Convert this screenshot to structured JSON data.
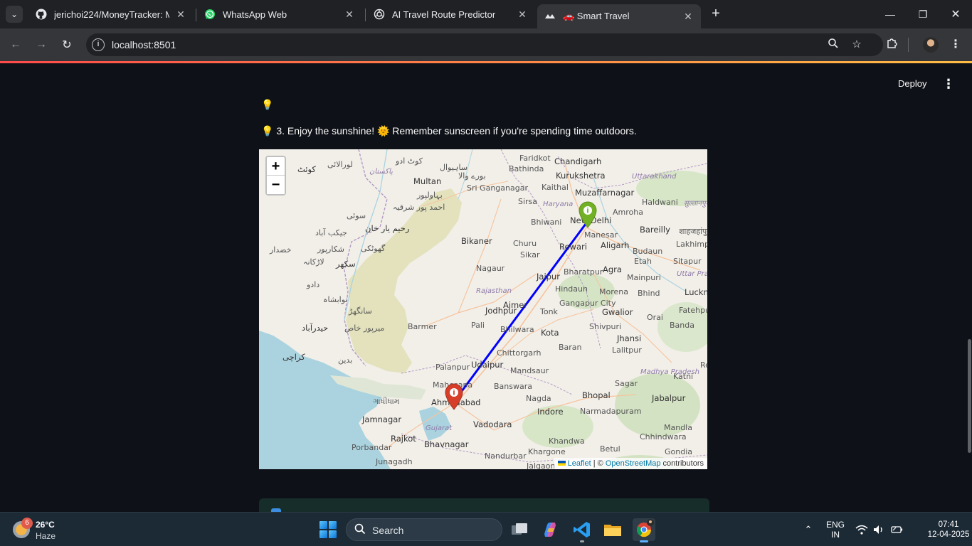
{
  "browser": {
    "tabs": [
      {
        "title": "jerichoi224/MoneyTracker: Mon",
        "icon": "github-icon"
      },
      {
        "title": "WhatsApp Web",
        "icon": "whatsapp-icon"
      },
      {
        "title": "AI Travel Route Predictor",
        "icon": "openai-icon"
      },
      {
        "title": "🚗 Smart Travel",
        "icon": "streamlit-icon",
        "active": true
      }
    ],
    "url": "localhost:8501"
  },
  "app": {
    "deploy_label": "Deploy",
    "tip_empty": "💡",
    "tip_text": "💡 3. Enjoy the sunshine! 🌞 Remember sunscreen if you're spending time outdoors."
  },
  "map": {
    "zoom_in": "+",
    "zoom_out": "−",
    "attribution": {
      "leaflet": "Leaflet",
      "sep": " | © ",
      "osm": "OpenStreetMap",
      "suffix": " contributors"
    },
    "route_color": "#0000ff",
    "start_marker_color": "#72b026",
    "end_marker_color": "#d63e2a",
    "places": [
      {
        "label": "Chandigarh",
        "cls": "city"
      },
      {
        "label": "Kurukshetra",
        "cls": "city"
      },
      {
        "label": "Muzaffarnagar",
        "cls": "city"
      },
      {
        "label": "Uttarakhand",
        "cls": "region"
      },
      {
        "label": "Faridkot",
        "cls": ""
      },
      {
        "label": "Bathinda",
        "cls": ""
      },
      {
        "label": "Kaithal",
        "cls": ""
      },
      {
        "label": "Sri Ganganagar",
        "cls": ""
      },
      {
        "label": "Haryana",
        "cls": "region"
      },
      {
        "label": "Sirsa",
        "cls": ""
      },
      {
        "label": "Haldwani",
        "cls": ""
      },
      {
        "label": "Amroha",
        "cls": ""
      },
      {
        "label": "Bhiwani",
        "cls": ""
      },
      {
        "label": "New Delhi",
        "cls": "city"
      },
      {
        "label": "Manesar",
        "cls": ""
      },
      {
        "label": "Bareilly",
        "cls": "city"
      },
      {
        "label": "Aligarh",
        "cls": "city"
      },
      {
        "label": "Lakhimpur",
        "cls": ""
      },
      {
        "label": "Rewari",
        "cls": "city"
      },
      {
        "label": "Bikaner",
        "cls": "city"
      },
      {
        "label": "Churu",
        "cls": ""
      },
      {
        "label": "Budaun",
        "cls": ""
      },
      {
        "label": "Sikar",
        "cls": ""
      },
      {
        "label": "Etah",
        "cls": ""
      },
      {
        "label": "Sitapur",
        "cls": ""
      },
      {
        "label": "Bharatpur",
        "cls": ""
      },
      {
        "label": "Nagaur",
        "cls": ""
      },
      {
        "label": "Jaipur",
        "cls": "city"
      },
      {
        "label": "Agra",
        "cls": "city"
      },
      {
        "label": "Mainpuri",
        "cls": ""
      },
      {
        "label": "Uttar Prade",
        "cls": "region"
      },
      {
        "label": "Rajasthan",
        "cls": "region"
      },
      {
        "label": "Hindaun",
        "cls": ""
      },
      {
        "label": "Morena",
        "cls": ""
      },
      {
        "label": "Bhind",
        "cls": ""
      },
      {
        "label": "Luckno",
        "cls": "city"
      },
      {
        "label": "Gangapur City",
        "cls": ""
      },
      {
        "label": "Ajmer",
        "cls": "city"
      },
      {
        "label": "Tonk",
        "cls": ""
      },
      {
        "label": "Gwalior",
        "cls": "city"
      },
      {
        "label": "Fatehpur",
        "cls": ""
      },
      {
        "label": "Jodhpur",
        "cls": "city"
      },
      {
        "label": "Orai",
        "cls": ""
      },
      {
        "label": "Barmer",
        "cls": ""
      },
      {
        "label": "Pali",
        "cls": ""
      },
      {
        "label": "Bhilwara",
        "cls": ""
      },
      {
        "label": "Kota",
        "cls": "city"
      },
      {
        "label": "Shivpuri",
        "cls": ""
      },
      {
        "label": "Banda",
        "cls": ""
      },
      {
        "label": "Jhansi",
        "cls": "city"
      },
      {
        "label": "Chittorgarh",
        "cls": ""
      },
      {
        "label": "Baran",
        "cls": ""
      },
      {
        "label": "Lalitpur",
        "cls": ""
      },
      {
        "label": "Palanpur",
        "cls": ""
      },
      {
        "label": "Udaipur",
        "cls": "city"
      },
      {
        "label": "Mandsaur",
        "cls": ""
      },
      {
        "label": "Madhya Pradesh",
        "cls": "region"
      },
      {
        "label": "Katni",
        "cls": ""
      },
      {
        "label": "Re",
        "cls": ""
      },
      {
        "label": "Mahesana",
        "cls": ""
      },
      {
        "label": "Banswara",
        "cls": ""
      },
      {
        "label": "Sagar",
        "cls": ""
      },
      {
        "label": "Ahmedabad",
        "cls": "city"
      },
      {
        "label": "Nagda",
        "cls": ""
      },
      {
        "label": "Bhopal",
        "cls": "city"
      },
      {
        "label": "Jabalpur",
        "cls": "city"
      },
      {
        "label": "Indore",
        "cls": "city"
      },
      {
        "label": "Narmadapuram",
        "cls": ""
      },
      {
        "label": "Jamnagar",
        "cls": "city"
      },
      {
        "label": "Vadodara",
        "cls": "city"
      },
      {
        "label": "Gujarat",
        "cls": "region"
      },
      {
        "label": "Mandla",
        "cls": ""
      },
      {
        "label": "Rajkot",
        "cls": "city"
      },
      {
        "label": "Chhindwara",
        "cls": ""
      },
      {
        "label": "Bhavnagar",
        "cls": "city"
      },
      {
        "label": "Khandwa",
        "cls": ""
      },
      {
        "label": "Porbandar",
        "cls": ""
      },
      {
        "label": "Khargone",
        "cls": ""
      },
      {
        "label": "Betul",
        "cls": ""
      },
      {
        "label": "Gondia",
        "cls": ""
      },
      {
        "label": "Nandurbar",
        "cls": ""
      },
      {
        "label": "Junagadh",
        "cls": ""
      },
      {
        "label": "Jalgaon",
        "cls": ""
      },
      {
        "label": "Multan",
        "cls": "city"
      },
      {
        "label": "پاکستان",
        "cls": "region"
      },
      {
        "label": "بہاولپور",
        "cls": ""
      },
      {
        "label": "رحیم یار خان",
        "cls": "city"
      },
      {
        "label": "سکھر",
        "cls": "city"
      },
      {
        "label": "کراچی",
        "cls": "city"
      },
      {
        "label": "حیدرآباد",
        "cls": "city"
      },
      {
        "label": "کوٹ ادو",
        "cls": ""
      },
      {
        "label": "لورالائی",
        "cls": ""
      },
      {
        "label": "کوئٹ",
        "cls": "city"
      },
      {
        "label": "ساہیوال",
        "cls": ""
      },
      {
        "label": "بورے والا",
        "cls": ""
      },
      {
        "label": "احمد پور شرقیہ",
        "cls": ""
      },
      {
        "label": "سوئی",
        "cls": ""
      },
      {
        "label": "جیکب آباد",
        "cls": ""
      },
      {
        "label": "گھوٹکی",
        "cls": ""
      },
      {
        "label": "شکارپور",
        "cls": ""
      },
      {
        "label": "لاڑکانہ",
        "cls": ""
      },
      {
        "label": "خضدار",
        "cls": ""
      },
      {
        "label": "دادو",
        "cls": ""
      },
      {
        "label": "نوابشاہ",
        "cls": ""
      },
      {
        "label": "سانگھڑ",
        "cls": ""
      },
      {
        "label": "میرپور خاص",
        "cls": ""
      },
      {
        "label": "بدین",
        "cls": ""
      },
      {
        "label": "ગાંધીધામ",
        "cls": ""
      },
      {
        "label": "सुल्तानपुर",
        "cls": "region"
      },
      {
        "label": "शाहजहांपुर",
        "cls": ""
      }
    ]
  },
  "taskbar": {
    "weather_badge": "6",
    "temp": "26°C",
    "condition": "Haze",
    "search": "Search",
    "lang": "ENG",
    "region": "IN",
    "time": "07:41",
    "date": "12-04-2025"
  }
}
